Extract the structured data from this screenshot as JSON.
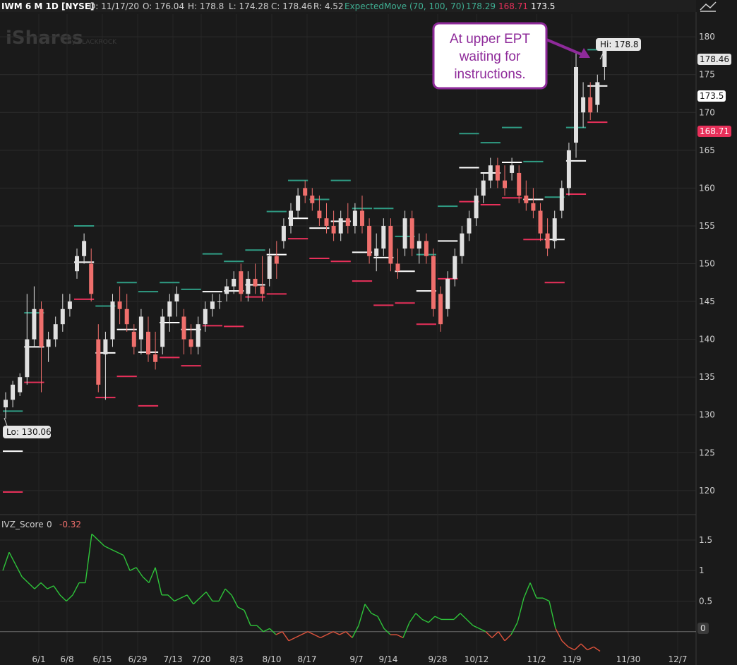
{
  "header": {
    "symbol": "IWM 6 M 1D [NYSE]",
    "date": "D: 11/17/20",
    "open": "O: 176.04",
    "high": "H: 178.8",
    "low": "L: 174.28",
    "close": "C: 178.46",
    "range": "R: 4.52",
    "study": "ExpectedMove (70, 100, 70)",
    "study_v1": "178.29",
    "study_v2": "168.71",
    "study_v3": "173.5"
  },
  "watermark": {
    "brand": "iShares",
    "by": "by BLACKROCK"
  },
  "annotation": {
    "text_lines": [
      "At upper EPT",
      "waiting for",
      "instructions."
    ]
  },
  "price_tags": {
    "last": "178.46",
    "mid": "173.5",
    "lower": "168.71"
  },
  "hi_label": "Hi: 178.8",
  "lo_label": "Lo: 130.06",
  "lower_panel": {
    "label": "IVZ_Score",
    "value1": "0",
    "value2": "-0.32"
  },
  "colors": {
    "up": "#e0e0e0",
    "down": "#ef6f6c",
    "upper_em": "#2f9c84",
    "lower_em": "#e8305a",
    "mid_em": "#ffffff",
    "ivz_pos": "#2ec43a",
    "ivz_neg": "#e0533c",
    "annotation": "#8e2a9a"
  },
  "chart_data": {
    "type": "candlestick",
    "x_tick_labels": [
      "6/1",
      "6/8",
      "6/15",
      "6/29",
      "7/13",
      "7/20",
      "8/3",
      "8/10",
      "8/17",
      "9/7",
      "9/14",
      "9/28",
      "10/12",
      "11/2",
      "11/9",
      "11/30",
      "12/7"
    ],
    "y_ticks": [
      120,
      125,
      130,
      135,
      140,
      145,
      150,
      155,
      160,
      165,
      170,
      175,
      180
    ],
    "ylim": [
      117,
      183
    ],
    "candles": [
      [
        131,
        133,
        129.5,
        132
      ],
      [
        132,
        134.5,
        131,
        134
      ],
      [
        133,
        135.5,
        132.5,
        135
      ],
      [
        135,
        146,
        134,
        140
      ],
      [
        140,
        147,
        139,
        144
      ],
      [
        144,
        145,
        133,
        139
      ],
      [
        139,
        141,
        137,
        140
      ],
      [
        140,
        143,
        139,
        142
      ],
      [
        142,
        146,
        141,
        144
      ],
      [
        144,
        146,
        143,
        145
      ],
      [
        149,
        152,
        148,
        151
      ],
      [
        151,
        154,
        150,
        153
      ],
      [
        150,
        152,
        145,
        146
      ],
      [
        140,
        142,
        133,
        134
      ],
      [
        138,
        141,
        132,
        140
      ],
      [
        140,
        146,
        139,
        145
      ],
      [
        145,
        147,
        142,
        144
      ],
      [
        144,
        146,
        141,
        142
      ],
      [
        141,
        142,
        138,
        139
      ],
      [
        140,
        144,
        138,
        143
      ],
      [
        141,
        143,
        137,
        138
      ],
      [
        138,
        141,
        136,
        137
      ],
      [
        139,
        144,
        138,
        143
      ],
      [
        143,
        146,
        141,
        145
      ],
      [
        145,
        147,
        143,
        146
      ],
      [
        143,
        144,
        138,
        140
      ],
      [
        140,
        142,
        138,
        139
      ],
      [
        139,
        143,
        138,
        142
      ],
      [
        142,
        145,
        141,
        144
      ],
      [
        144,
        146,
        143,
        145
      ],
      [
        145,
        146,
        144,
        145
      ],
      [
        146,
        148,
        145,
        147
      ],
      [
        147,
        149,
        146,
        148
      ],
      [
        149,
        150,
        145,
        146
      ],
      [
        146,
        149,
        145,
        148
      ],
      [
        148,
        150,
        146,
        147
      ],
      [
        147,
        151,
        145,
        146
      ],
      [
        148,
        152,
        147,
        151
      ],
      [
        151,
        153,
        148,
        150
      ],
      [
        153,
        156,
        152,
        155
      ],
      [
        155,
        158,
        154,
        157
      ],
      [
        157,
        160,
        156,
        159
      ],
      [
        160,
        161,
        158,
        159
      ],
      [
        159,
        160,
        157,
        158
      ],
      [
        157,
        159,
        155,
        156
      ],
      [
        156,
        158,
        154,
        155
      ],
      [
        155,
        157,
        153,
        154
      ],
      [
        154,
        157,
        153,
        156
      ],
      [
        156,
        158,
        154,
        155
      ],
      [
        155,
        158,
        154,
        157
      ],
      [
        157,
        159,
        154,
        155
      ],
      [
        155,
        156,
        150,
        151
      ],
      [
        151,
        154,
        149,
        152
      ],
      [
        152,
        156,
        151,
        155
      ],
      [
        155,
        156,
        149,
        150
      ],
      [
        150,
        152,
        148,
        149
      ],
      [
        152,
        157,
        151,
        156
      ],
      [
        156,
        157,
        151,
        152
      ],
      [
        152,
        154,
        150,
        153
      ],
      [
        153,
        154,
        150,
        151
      ],
      [
        151,
        152,
        143,
        144
      ],
      [
        146,
        147,
        141,
        142
      ],
      [
        144,
        149,
        143,
        148
      ],
      [
        148,
        152,
        147,
        151
      ],
      [
        151,
        155,
        150,
        154
      ],
      [
        154,
        157,
        153,
        156
      ],
      [
        156,
        160,
        155,
        159
      ],
      [
        159,
        162,
        158,
        161
      ],
      [
        161,
        164,
        160,
        163
      ],
      [
        163,
        164,
        160,
        161
      ],
      [
        161,
        163,
        159,
        160
      ],
      [
        162,
        164,
        161,
        163
      ],
      [
        162,
        163,
        158,
        159
      ],
      [
        159,
        161,
        157,
        158
      ],
      [
        158,
        160,
        156,
        157
      ],
      [
        157,
        158,
        153,
        154
      ],
      [
        154,
        156,
        151,
        152
      ],
      [
        153,
        157,
        152,
        156
      ],
      [
        157,
        161,
        156,
        160
      ],
      [
        160,
        166,
        159,
        165
      ],
      [
        166,
        178,
        164,
        176
      ],
      [
        170,
        174,
        168,
        172
      ],
      [
        172,
        174,
        169,
        170
      ],
      [
        171,
        175,
        170,
        174
      ],
      [
        176,
        178.8,
        174.3,
        178.5
      ]
    ],
    "expected_move": [
      {
        "x0": 0,
        "x1": 2,
        "upper": 130.5,
        "mid": 125.2,
        "lower": 119.8
      },
      {
        "x0": 3,
        "x1": 5,
        "upper": 143.5,
        "mid": 139,
        "lower": 134.3
      },
      {
        "x0": 10,
        "x1": 12,
        "upper": 155,
        "mid": 150.2,
        "lower": 145.3
      },
      {
        "x0": 13,
        "x1": 15,
        "upper": 144.4,
        "mid": 138.2,
        "lower": 132.3
      },
      {
        "x0": 16,
        "x1": 18,
        "upper": 147.5,
        "mid": 141.3,
        "lower": 135.1
      },
      {
        "x0": 19,
        "x1": 21,
        "upper": 146.3,
        "mid": 138.3,
        "lower": 131.2
      },
      {
        "x0": 22,
        "x1": 24,
        "upper": 147.5,
        "mid": 142.2,
        "lower": 137.6
      },
      {
        "x0": 25,
        "x1": 27,
        "upper": 146.6,
        "mid": 141.3,
        "lower": 136.5
      },
      {
        "x0": 28,
        "x1": 30,
        "upper": 151.3,
        "mid": 146.3,
        "lower": 141.8
      },
      {
        "x0": 31,
        "x1": 33,
        "upper": 150.3,
        "mid": 146.4,
        "lower": 141.7
      },
      {
        "x0": 34,
        "x1": 36,
        "upper": 151.8,
        "mid": 147.2,
        "lower": 145.6
      },
      {
        "x0": 37,
        "x1": 39,
        "upper": 156.9,
        "mid": 151.2,
        "lower": 146
      },
      {
        "x0": 40,
        "x1": 42,
        "upper": 161,
        "mid": 156,
        "lower": 153.3
      },
      {
        "x0": 43,
        "x1": 45,
        "upper": 158.5,
        "mid": 154.7,
        "lower": 150.7
      },
      {
        "x0": 46,
        "x1": 48,
        "upper": 161,
        "mid": 155.6,
        "lower": 150.3
      },
      {
        "x0": 49,
        "x1": 51,
        "upper": 157.3,
        "mid": 151.5,
        "lower": 147.7
      },
      {
        "x0": 52,
        "x1": 54,
        "upper": 157.3,
        "mid": 150.8,
        "lower": 144.5
      },
      {
        "x0": 55,
        "x1": 57,
        "upper": 153.6,
        "mid": 149,
        "lower": 144.8
      },
      {
        "x0": 58,
        "x1": 60,
        "upper": 151.2,
        "mid": 146.4,
        "lower": 142
      },
      {
        "x0": 61,
        "x1": 63,
        "upper": 157.6,
        "mid": 153,
        "lower": 148
      },
      {
        "x0": 64,
        "x1": 66,
        "upper": 167.2,
        "mid": 162.7,
        "lower": 158.2
      },
      {
        "x0": 67,
        "x1": 69,
        "upper": 166,
        "mid": 162,
        "lower": 157.8
      },
      {
        "x0": 70,
        "x1": 72,
        "upper": 168,
        "mid": 163.4,
        "lower": 158.7
      },
      {
        "x0": 73,
        "x1": 75,
        "upper": 163.5,
        "mid": 158.5,
        "lower": 153.2
      },
      {
        "x0": 76,
        "x1": 78,
        "upper": 158.8,
        "mid": 153.2,
        "lower": 147.5
      },
      {
        "x0": 79,
        "x1": 81,
        "upper": 168,
        "mid": 163.6,
        "lower": 159.2
      },
      {
        "x0": 82,
        "x1": 84,
        "upper": 178.3,
        "mid": 173.5,
        "lower": 168.7
      }
    ],
    "ivz_score": [
      1.0,
      1.3,
      1.1,
      0.9,
      0.8,
      0.7,
      0.8,
      0.7,
      0.75,
      0.6,
      0.5,
      0.6,
      0.8,
      0.8,
      1.6,
      1.5,
      1.4,
      1.35,
      1.3,
      1.25,
      1.0,
      1.05,
      0.9,
      0.8,
      1.05,
      0.6,
      0.6,
      0.5,
      0.55,
      0.6,
      0.45,
      0.55,
      0.65,
      0.5,
      0.5,
      0.7,
      0.6,
      0.4,
      0.35,
      0.1,
      0.1,
      0.0,
      0.05,
      -0.05,
      0.0,
      -0.15,
      -0.1,
      -0.05,
      0.0,
      -0.05,
      -0.1,
      -0.05,
      0.0,
      -0.05,
      0.0,
      -0.1,
      0.1,
      0.45,
      0.3,
      0.25,
      0.05,
      -0.05,
      -0.05,
      -0.1,
      0.15,
      0.3,
      0.2,
      0.15,
      0.25,
      0.2,
      0.2,
      0.2,
      0.3,
      0.2,
      0.1,
      0.05,
      0.0,
      -0.1,
      0.0,
      -0.15,
      -0.05,
      0.15,
      0.55,
      0.8,
      0.55,
      0.55,
      0.5,
      0.05,
      -0.15,
      -0.25,
      -0.3,
      -0.2,
      -0.3,
      -0.25,
      -0.32
    ],
    "ivz_ylim": [
      -0.35,
      1.65
    ],
    "ivz_ticks": [
      0,
      0.5,
      1,
      1.5
    ]
  }
}
